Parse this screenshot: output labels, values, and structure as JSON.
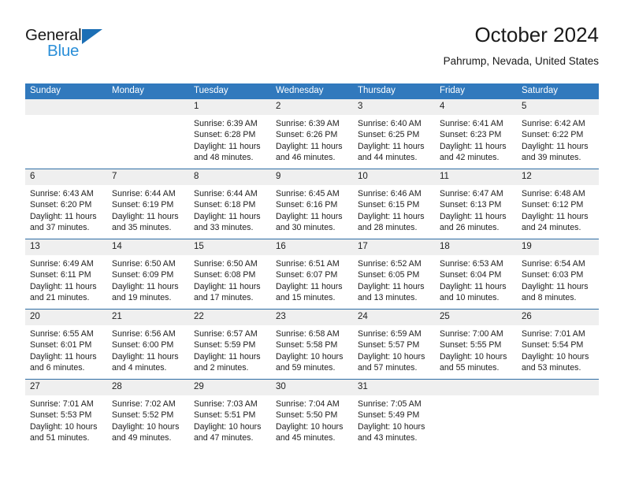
{
  "brand": {
    "name_part1": "General",
    "name_part2": "Blue",
    "accent_color": "#2b8fd8",
    "triangle_color": "#1c6fb5"
  },
  "header": {
    "title": "October 2024",
    "subtitle": "Pahrump, Nevada, United States"
  },
  "theme": {
    "header_row_bg": "#3179bd",
    "daynum_bg": "#efefef",
    "row_divider": "#2e6da4"
  },
  "calendar": {
    "weekday_headers": [
      "Sunday",
      "Monday",
      "Tuesday",
      "Wednesday",
      "Thursday",
      "Friday",
      "Saturday"
    ],
    "weeks": [
      [
        {
          "day": "",
          "lines": []
        },
        {
          "day": "",
          "lines": []
        },
        {
          "day": "1",
          "lines": [
            "Sunrise: 6:39 AM",
            "Sunset: 6:28 PM",
            "Daylight: 11 hours",
            "and 48 minutes."
          ]
        },
        {
          "day": "2",
          "lines": [
            "Sunrise: 6:39 AM",
            "Sunset: 6:26 PM",
            "Daylight: 11 hours",
            "and 46 minutes."
          ]
        },
        {
          "day": "3",
          "lines": [
            "Sunrise: 6:40 AM",
            "Sunset: 6:25 PM",
            "Daylight: 11 hours",
            "and 44 minutes."
          ]
        },
        {
          "day": "4",
          "lines": [
            "Sunrise: 6:41 AM",
            "Sunset: 6:23 PM",
            "Daylight: 11 hours",
            "and 42 minutes."
          ]
        },
        {
          "day": "5",
          "lines": [
            "Sunrise: 6:42 AM",
            "Sunset: 6:22 PM",
            "Daylight: 11 hours",
            "and 39 minutes."
          ]
        }
      ],
      [
        {
          "day": "6",
          "lines": [
            "Sunrise: 6:43 AM",
            "Sunset: 6:20 PM",
            "Daylight: 11 hours",
            "and 37 minutes."
          ]
        },
        {
          "day": "7",
          "lines": [
            "Sunrise: 6:44 AM",
            "Sunset: 6:19 PM",
            "Daylight: 11 hours",
            "and 35 minutes."
          ]
        },
        {
          "day": "8",
          "lines": [
            "Sunrise: 6:44 AM",
            "Sunset: 6:18 PM",
            "Daylight: 11 hours",
            "and 33 minutes."
          ]
        },
        {
          "day": "9",
          "lines": [
            "Sunrise: 6:45 AM",
            "Sunset: 6:16 PM",
            "Daylight: 11 hours",
            "and 30 minutes."
          ]
        },
        {
          "day": "10",
          "lines": [
            "Sunrise: 6:46 AM",
            "Sunset: 6:15 PM",
            "Daylight: 11 hours",
            "and 28 minutes."
          ]
        },
        {
          "day": "11",
          "lines": [
            "Sunrise: 6:47 AM",
            "Sunset: 6:13 PM",
            "Daylight: 11 hours",
            "and 26 minutes."
          ]
        },
        {
          "day": "12",
          "lines": [
            "Sunrise: 6:48 AM",
            "Sunset: 6:12 PM",
            "Daylight: 11 hours",
            "and 24 minutes."
          ]
        }
      ],
      [
        {
          "day": "13",
          "lines": [
            "Sunrise: 6:49 AM",
            "Sunset: 6:11 PM",
            "Daylight: 11 hours",
            "and 21 minutes."
          ]
        },
        {
          "day": "14",
          "lines": [
            "Sunrise: 6:50 AM",
            "Sunset: 6:09 PM",
            "Daylight: 11 hours",
            "and 19 minutes."
          ]
        },
        {
          "day": "15",
          "lines": [
            "Sunrise: 6:50 AM",
            "Sunset: 6:08 PM",
            "Daylight: 11 hours",
            "and 17 minutes."
          ]
        },
        {
          "day": "16",
          "lines": [
            "Sunrise: 6:51 AM",
            "Sunset: 6:07 PM",
            "Daylight: 11 hours",
            "and 15 minutes."
          ]
        },
        {
          "day": "17",
          "lines": [
            "Sunrise: 6:52 AM",
            "Sunset: 6:05 PM",
            "Daylight: 11 hours",
            "and 13 minutes."
          ]
        },
        {
          "day": "18",
          "lines": [
            "Sunrise: 6:53 AM",
            "Sunset: 6:04 PM",
            "Daylight: 11 hours",
            "and 10 minutes."
          ]
        },
        {
          "day": "19",
          "lines": [
            "Sunrise: 6:54 AM",
            "Sunset: 6:03 PM",
            "Daylight: 11 hours",
            "and 8 minutes."
          ]
        }
      ],
      [
        {
          "day": "20",
          "lines": [
            "Sunrise: 6:55 AM",
            "Sunset: 6:01 PM",
            "Daylight: 11 hours",
            "and 6 minutes."
          ]
        },
        {
          "day": "21",
          "lines": [
            "Sunrise: 6:56 AM",
            "Sunset: 6:00 PM",
            "Daylight: 11 hours",
            "and 4 minutes."
          ]
        },
        {
          "day": "22",
          "lines": [
            "Sunrise: 6:57 AM",
            "Sunset: 5:59 PM",
            "Daylight: 11 hours",
            "and 2 minutes."
          ]
        },
        {
          "day": "23",
          "lines": [
            "Sunrise: 6:58 AM",
            "Sunset: 5:58 PM",
            "Daylight: 10 hours",
            "and 59 minutes."
          ]
        },
        {
          "day": "24",
          "lines": [
            "Sunrise: 6:59 AM",
            "Sunset: 5:57 PM",
            "Daylight: 10 hours",
            "and 57 minutes."
          ]
        },
        {
          "day": "25",
          "lines": [
            "Sunrise: 7:00 AM",
            "Sunset: 5:55 PM",
            "Daylight: 10 hours",
            "and 55 minutes."
          ]
        },
        {
          "day": "26",
          "lines": [
            "Sunrise: 7:01 AM",
            "Sunset: 5:54 PM",
            "Daylight: 10 hours",
            "and 53 minutes."
          ]
        }
      ],
      [
        {
          "day": "27",
          "lines": [
            "Sunrise: 7:01 AM",
            "Sunset: 5:53 PM",
            "Daylight: 10 hours",
            "and 51 minutes."
          ]
        },
        {
          "day": "28",
          "lines": [
            "Sunrise: 7:02 AM",
            "Sunset: 5:52 PM",
            "Daylight: 10 hours",
            "and 49 minutes."
          ]
        },
        {
          "day": "29",
          "lines": [
            "Sunrise: 7:03 AM",
            "Sunset: 5:51 PM",
            "Daylight: 10 hours",
            "and 47 minutes."
          ]
        },
        {
          "day": "30",
          "lines": [
            "Sunrise: 7:04 AM",
            "Sunset: 5:50 PM",
            "Daylight: 10 hours",
            "and 45 minutes."
          ]
        },
        {
          "day": "31",
          "lines": [
            "Sunrise: 7:05 AM",
            "Sunset: 5:49 PM",
            "Daylight: 10 hours",
            "and 43 minutes."
          ]
        },
        {
          "day": "",
          "lines": []
        },
        {
          "day": "",
          "lines": []
        }
      ]
    ]
  }
}
